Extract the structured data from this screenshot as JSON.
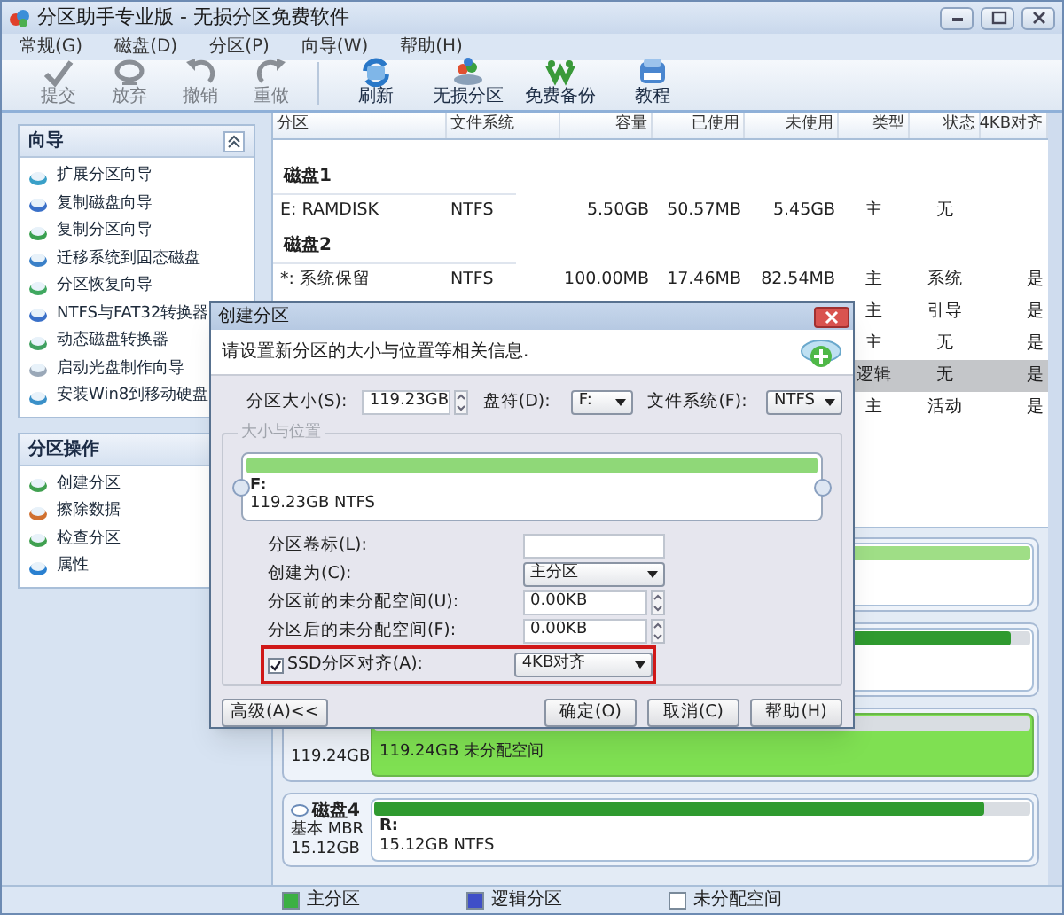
{
  "window": {
    "title": "分区助手专业版 - 无损分区免费软件"
  },
  "menu": [
    "常规(G)",
    "磁盘(D)",
    "分区(P)",
    "向导(W)",
    "帮助(H)"
  ],
  "toolbar_groups": [
    [
      {
        "label": "提交",
        "disabled": true
      },
      {
        "label": "放弃",
        "disabled": true
      },
      {
        "label": "撤销",
        "disabled": true
      },
      {
        "label": "重做",
        "disabled": true
      }
    ],
    [
      {
        "label": "刷新",
        "disabled": false
      },
      {
        "label": "无损分区",
        "disabled": false
      },
      {
        "label": "免费备份",
        "disabled": false
      },
      {
        "label": "教程",
        "disabled": false
      }
    ]
  ],
  "sidebar": {
    "panels": [
      {
        "title": "向导",
        "expanded": true,
        "items": [
          "扩展分区向导",
          "复制磁盘向导",
          "复制分区向导",
          "迁移系统到固态磁盘",
          "分区恢复向导",
          "NTFS与FAT32转换器",
          "动态磁盘转换器",
          "启动光盘制作向导",
          "安装Win8到移动硬盘"
        ]
      },
      {
        "title": "分区操作",
        "items": [
          "创建分区",
          "擦除数据",
          "检查分区",
          "属性"
        ]
      }
    ]
  },
  "table": {
    "columns": [
      "分区",
      "文件系统",
      "容量",
      "已使用",
      "未使用",
      "类型",
      "状态",
      "4KB对齐"
    ],
    "rows": [
      {
        "kind": "disk",
        "label": "磁盘1"
      },
      {
        "kind": "partition",
        "partition": "E: RAMDISK",
        "file_system": "NTFS",
        "capacity": "5.50GB",
        "used": "50.57MB",
        "unused": "5.45GB",
        "type": "主",
        "status": "无",
        "selected": false
      },
      {
        "kind": "disk",
        "label": "磁盘2"
      },
      {
        "kind": "partition",
        "partition": "*: 系统保留",
        "file_system": "NTFS",
        "capacity": "100.00MB",
        "used": "17.46MB",
        "unused": "82.54MB",
        "type": "主",
        "status": "系统",
        "aligned": "是",
        "selected": false
      },
      {
        "kind": "partition",
        "type": "主",
        "status": "引导",
        "aligned": "是",
        "selected": false
      },
      {
        "kind": "partition",
        "type": "主",
        "status": "无",
        "aligned": "是",
        "selected": false
      },
      {
        "kind": "partition",
        "type": "逻辑",
        "status": "无",
        "aligned": "是",
        "selected": true
      },
      {
        "kind": "partition",
        "type": "主",
        "status": "活动",
        "aligned": "是",
        "selected": false
      }
    ]
  },
  "disk_map": [
    {
      "partitions": [
        {
          "kind": "primary",
          "level": 1.0,
          "selected": false
        }
      ]
    },
    {
      "partitions": [
        {
          "kind": "primary",
          "level": 0.97,
          "selected": false
        }
      ]
    },
    {
      "size": "119.24GB",
      "partitions": [
        {
          "kind": "unallocated",
          "details": "119.24GB 未分配空间",
          "selected": true
        }
      ]
    },
    {
      "name": "磁盘4",
      "type": "基本 MBR",
      "size": "15.12GB",
      "partitions": [
        {
          "kind": "primary",
          "label": "R:",
          "details": "15.12GB NTFS",
          "level": 0.93,
          "selected": false
        }
      ]
    }
  ],
  "legend": [
    {
      "label": "主分区",
      "color": "#3cb043"
    },
    {
      "label": "逻辑分区",
      "color": "#3f4fc8"
    },
    {
      "label": "未分配空间",
      "color": "#ffffff"
    }
  ],
  "dialog": {
    "title": "创建分区",
    "prompt": "请设置新分区的大小与位置等相关信息.",
    "size": {
      "label": "分区大小(S):",
      "value": "119.23GB"
    },
    "drive_letter": {
      "label": "盘符(D):",
      "value": "F:"
    },
    "file_system": {
      "label": "文件系统(F):",
      "value": "NTFS"
    },
    "group_title": "大小与位置",
    "partition": {
      "label": "F:",
      "details": "119.23GB NTFS",
      "level": 1.0
    },
    "fields": [
      {
        "kind": "text",
        "label": "分区卷标(L):"
      },
      {
        "kind": "select",
        "label": "创建为(C):",
        "value": "主分区"
      },
      {
        "kind": "spin",
        "label": "分区前的未分配空间(U):",
        "value": "0.00KB"
      },
      {
        "kind": "spin",
        "label": "分区后的未分配空间(F):",
        "value": "0.00KB"
      },
      {
        "kind": "checkbox_select",
        "label": "SSD分区对齐(A):",
        "checked": true,
        "value": "4KB对齐",
        "highlighted": true
      }
    ],
    "buttons_left": [
      "高级(A)<<"
    ],
    "buttons_right": [
      "确定(O)",
      "取消(C)",
      "帮助(H)"
    ]
  }
}
